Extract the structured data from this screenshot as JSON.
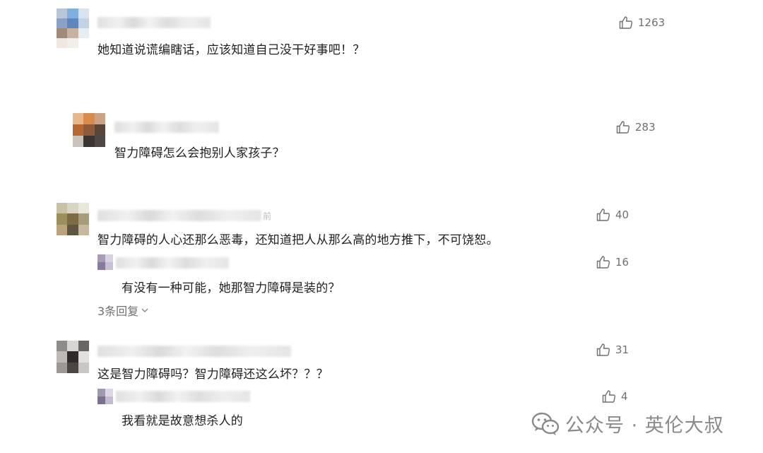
{
  "comments": [
    {
      "text": "她知道说谎编瞎话，应该知道自己没干好事吧！？",
      "likes": "1263"
    },
    {
      "text": "智力障碍怎么会抱别人家孩子？",
      "likes": "283"
    },
    {
      "text": "智力障碍的人心还那么恶毒，还知道把人从那么高的地方推下，不可饶恕。",
      "likes": "40",
      "time_suffix": "前",
      "reply": {
        "text": "有没有一种可能，她那智力障碍是装的？",
        "likes": "16"
      },
      "replies_link": "3条回复"
    },
    {
      "text": "这是智力障碍吗？智力障碍还这么坏？？？",
      "likes": "31",
      "reply": {
        "text": "我看就是故意想杀人的",
        "likes": "4"
      }
    }
  ],
  "watermark": {
    "text": "公众号 · 英伦大叔",
    "icon": "wechat-icon"
  },
  "colors": {
    "text": "#1f1f1f",
    "meta": "#6f6f6f",
    "watermark": "#8a8a8a"
  }
}
